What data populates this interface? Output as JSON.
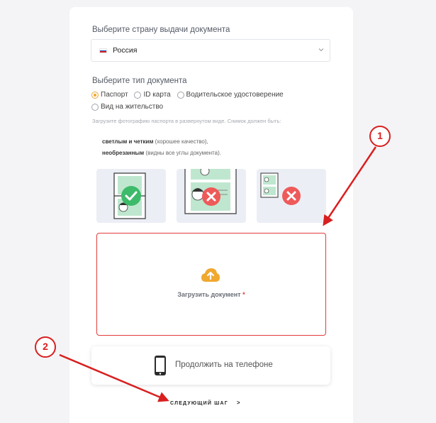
{
  "country": {
    "label": "Выберите страну выдачи документа",
    "selected": "Россия",
    "flag_colors": [
      "#ffffff",
      "#1e5bc6",
      "#d7262b"
    ]
  },
  "doc_type": {
    "label": "Выберите тип документа",
    "options": [
      {
        "label": "Паспорт",
        "selected": true
      },
      {
        "label": "ID карта",
        "selected": false
      },
      {
        "label": "Водительское удостоверение",
        "selected": false
      },
      {
        "label": "Вид на жительство",
        "selected": false
      }
    ]
  },
  "instructions": {
    "hint": "Загрузите фотографию паспорта в развернутом виде. Снимок должен быть:",
    "req1_bold": "светлым и четким",
    "req1_rest": " (хорошее качество),",
    "req2_bold": "необрезанным",
    "req2_rest": " (видны все углы документа)."
  },
  "examples": [
    {
      "icon": "check-icon",
      "status": "good"
    },
    {
      "icon": "cross-icon",
      "status": "bad"
    },
    {
      "icon": "cross-icon",
      "status": "bad"
    }
  ],
  "upload": {
    "label": "Загрузить документ",
    "required_mark": "*"
  },
  "phone_button": {
    "label": "Продолжить на телефоне"
  },
  "next_button": {
    "label": "СЛЕДУЮЩИЙ ШАГ",
    "arrow": ">"
  },
  "annotations": {
    "marker1": "1",
    "marker2": "2",
    "color": "#d91f1f"
  },
  "colors": {
    "accent": "#f0a830",
    "error": "#e33b3b",
    "ok": "#3dbb6a"
  }
}
